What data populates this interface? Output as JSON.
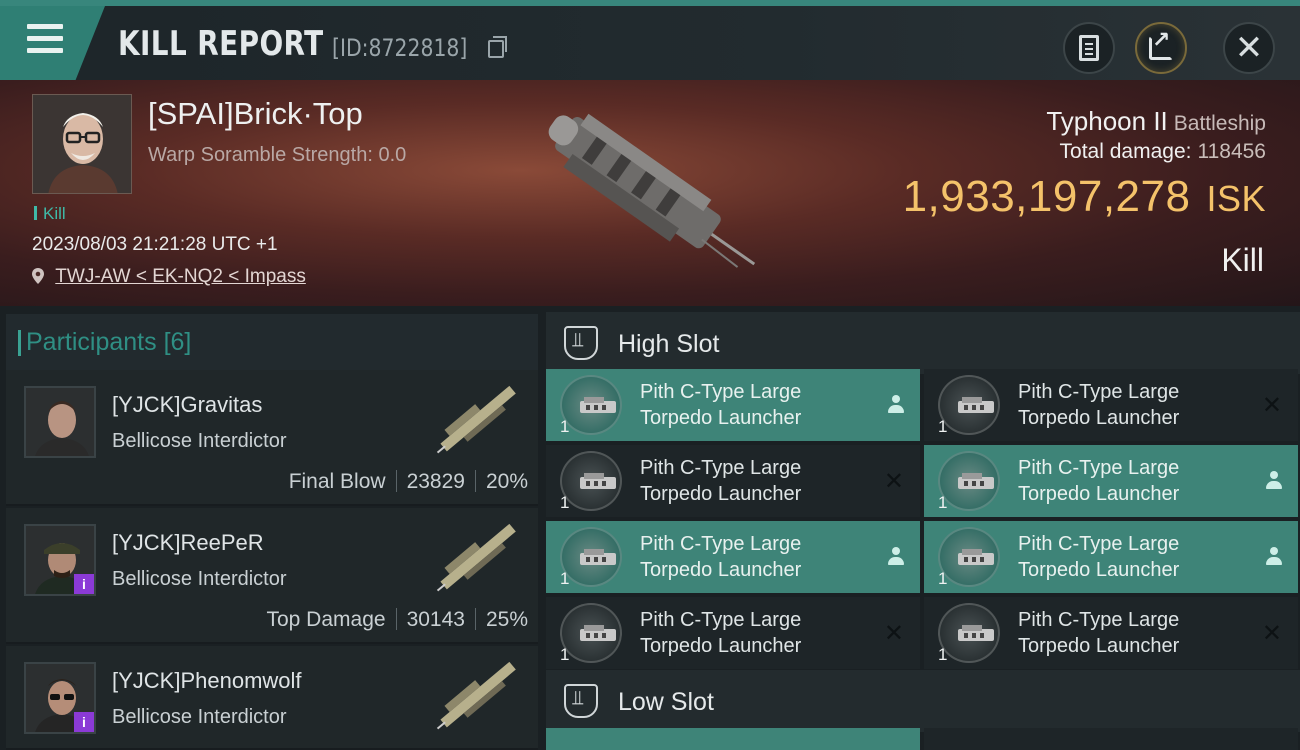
{
  "header": {
    "title": "KILL REPORT",
    "report_id": "[ID:8722818]",
    "icons": [
      "menu-icon",
      "copy-icon",
      "clipboard-icon",
      "share-icon",
      "close-icon"
    ]
  },
  "victim": {
    "name": "[SPAI]Brick·Top",
    "warp_scramble": "Warp Soramble Strength: 0.0",
    "tag": "Kill",
    "datetime": "2023/08/03 21:21:28 UTC +1",
    "location": "TWJ-AW < EK-NQ2 < Impass",
    "ship_name": "Typhoon II",
    "ship_class": "Battleship",
    "total_damage_label": "Total damage:",
    "total_damage": "118456",
    "isk_value": "1,933,197,278",
    "isk_unit": "ISK",
    "result": "Kill"
  },
  "participants": {
    "title": "Participants",
    "count": "[6]",
    "items": [
      {
        "name": "[YJCK]Gravitas",
        "ship": "Bellicose Interdictor",
        "role": "Final Blow",
        "damage": "23829",
        "percent": "20%",
        "badge": ""
      },
      {
        "name": "[YJCK]ReePeR",
        "ship": "Bellicose Interdictor",
        "role": "Top Damage",
        "damage": "30143",
        "percent": "25%",
        "badge": "i"
      },
      {
        "name": "[YJCK]Phenomwolf",
        "ship": "Bellicose Interdictor",
        "role": "",
        "damage": "",
        "percent": "",
        "badge": "i"
      }
    ]
  },
  "slots": {
    "high": {
      "title": "High Slot",
      "modules": [
        {
          "line1": "Pith C-Type Large",
          "line2": "Torpedo Launcher",
          "qty": "1",
          "dropped": true
        },
        {
          "line1": "Pith C-Type Large",
          "line2": "Torpedo Launcher",
          "qty": "1",
          "dropped": false
        },
        {
          "line1": "Pith C-Type Large",
          "line2": "Torpedo Launcher",
          "qty": "1",
          "dropped": false
        },
        {
          "line1": "Pith C-Type Large",
          "line2": "Torpedo Launcher",
          "qty": "1",
          "dropped": true
        },
        {
          "line1": "Pith C-Type Large",
          "line2": "Torpedo Launcher",
          "qty": "1",
          "dropped": true
        },
        {
          "line1": "Pith C-Type Large",
          "line2": "Torpedo Launcher",
          "qty": "1",
          "dropped": true
        },
        {
          "line1": "Pith C-Type Large",
          "line2": "Torpedo Launcher",
          "qty": "1",
          "dropped": false
        },
        {
          "line1": "Pith C-Type Large",
          "line2": "Torpedo Launcher",
          "qty": "1",
          "dropped": false
        }
      ],
      "destroyed_mark": "✕"
    },
    "low": {
      "title": "Low Slot"
    }
  },
  "colors": {
    "accent": "#38867c",
    "isk": "#f4c26a",
    "dropped": "#3e8478",
    "badge": "#8b3ad6"
  }
}
